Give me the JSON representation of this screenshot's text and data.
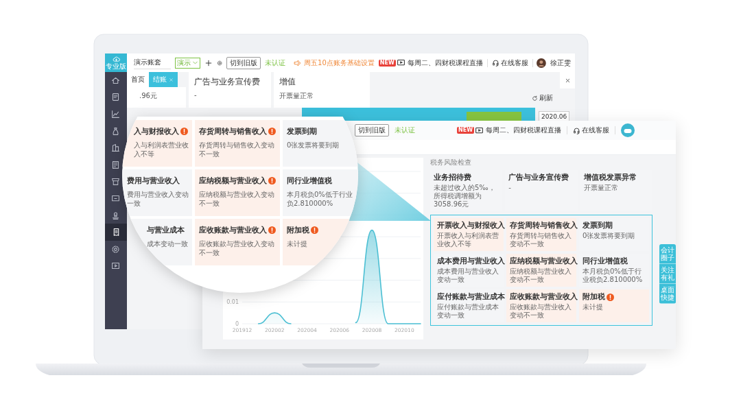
{
  "main_app": {
    "logo": {
      "label": "专业版"
    },
    "account": "演示账套",
    "mode_tag": "演示",
    "switch_button": "切到旧版",
    "cert_status": "未认证",
    "notices": [
      {
        "kind": "speaker",
        "text": "周五10点账务基础设置"
      },
      {
        "kind": "live",
        "badge": "NEW",
        "text": "每周二、四财税课程直播"
      }
    ],
    "support": "在线客服",
    "user_name": "徐正雯",
    "sidebar": [
      {
        "selected": false
      },
      {
        "selected": false
      },
      {
        "selected": false
      },
      {
        "selected": false
      },
      {
        "selected": false
      },
      {
        "selected": false
      },
      {
        "selected": false
      },
      {
        "selected": false
      },
      {
        "selected": false
      },
      {
        "selected": true
      },
      {
        "selected": false
      },
      {
        "selected": false
      }
    ],
    "tabs": [
      {
        "label": "首页",
        "selected": false,
        "closable": false
      },
      {
        "label": "结账",
        "selected": true,
        "closable": true
      }
    ],
    "cards": [
      {
        "desc": ".96元"
      },
      {
        "title": "广告与业务宣传费",
        "desc": "-"
      },
      {
        "title": "增值",
        "desc": "开票量正常"
      }
    ],
    "refresh": "刷新",
    "date": "2020.06"
  },
  "popup_window": {
    "switch_button": "切到旧版",
    "cert_status": "未认证",
    "notices": [
      {
        "kind": "live",
        "badge": "NEW",
        "text": "每周二、四财税课程直播"
      }
    ],
    "support": "在线客服",
    "chart_data": {
      "type": "area",
      "categories": [
        "201912",
        null,
        "202002",
        null,
        "202004",
        null,
        "202006",
        null,
        "202008",
        null,
        "202010",
        null
      ],
      "series": [
        {
          "color": "#4bbfd3",
          "values": [
            null,
            0,
            0.005,
            0,
            null,
            null,
            null,
            0.0005,
            0.043,
            0,
            0,
            0
          ]
        }
      ],
      "ylim": [
        0,
        0.07
      ],
      "yticks": [
        0,
        0.01
      ]
    },
    "risk_title": "税务风险检查",
    "summary_cards": [
      {
        "title": "业务招待费",
        "desc": "未超过收入的5‰，所得税调增额为3058.96元",
        "warning": false
      },
      {
        "title": "广告与业务宣传费",
        "desc": "-",
        "warning": false
      },
      {
        "title": "增值税发票异常",
        "desc": "开票量正常",
        "warning": false
      }
    ],
    "flagged_cards": [
      {
        "title": "开票收入与财报收入",
        "desc": "开票收入与利润表营业收入不等",
        "warning": true
      },
      {
        "title": "存货周转与销售收入",
        "desc": "存货周转与销售收入变动不一致",
        "warning": true
      },
      {
        "title": "发票到期",
        "desc": "0张发票将要到期",
        "warning": false
      },
      {
        "title": "成本费用与营业收入",
        "desc": "成本费用与营业收入变动一致",
        "warning": false
      },
      {
        "title": "应纳税额与营业收入",
        "desc": "应纳税额与营业收入变动不一致",
        "warning": true
      },
      {
        "title": "同行业增值税",
        "desc": "本月税负0%低于行业税负2.810000%",
        "warning": false
      },
      {
        "title": "应付账款与营业成本",
        "desc": "应付账款与营业成本变动一致",
        "warning": false
      },
      {
        "title": "应收账款与营业收入",
        "desc": "应收账款与营业收入变动不一致",
        "warning": true
      },
      {
        "title": "附加税",
        "desc": "未计提",
        "warning": true
      }
    ],
    "side_buttons": [
      "会计圈子",
      "关注有礼",
      "桌面快捷"
    ]
  },
  "magnifier": {
    "cards": [
      {
        "title": "入与财报收入",
        "desc": "入与利润表营业收入不等",
        "warning": true
      },
      {
        "title": "存货周转与销售收入",
        "desc": "存货周转与销售收入变动不一致",
        "warning": true
      },
      {
        "title": "发票到期",
        "desc": "0张发票将要到期",
        "warning": false
      },
      {
        "title": "费用与营业收入",
        "desc": "费用与营业收入变动一致",
        "warning": false
      },
      {
        "title": "应纳税额与营业收入",
        "desc": "应纳税额与营业收入变动不一致",
        "warning": true
      },
      {
        "title": "同行业增值税",
        "desc": "本月税负0%低于行业负2.810000%",
        "warning": false
      },
      {
        "title": "与营业成本",
        "desc": "成本变动一致",
        "warning": false
      },
      {
        "title": "应收账款与营业收入",
        "desc": "应收账款与营业收入变动不一致",
        "warning": true
      },
      {
        "title": "附加税",
        "desc": "未计提",
        "warning": true
      }
    ]
  }
}
